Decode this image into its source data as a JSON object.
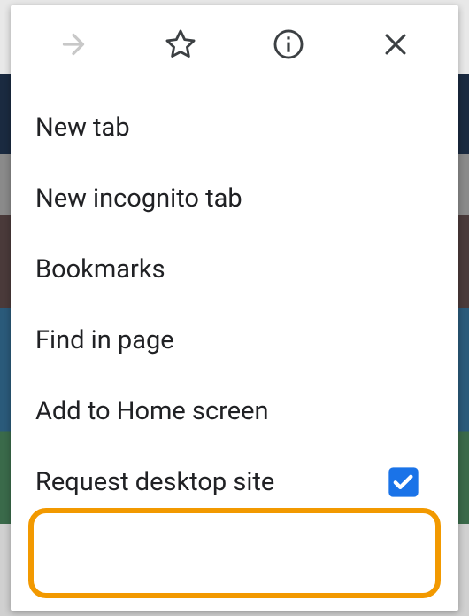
{
  "menu": {
    "items": [
      {
        "label": "New tab"
      },
      {
        "label": "New incognito tab"
      },
      {
        "label": "Bookmarks"
      },
      {
        "label": "Find in page"
      },
      {
        "label": "Add to Home screen"
      },
      {
        "label": "Request desktop site",
        "checked": true
      }
    ]
  },
  "colors": {
    "highlight": "#f29900",
    "checkbox": "#1a73e8"
  }
}
